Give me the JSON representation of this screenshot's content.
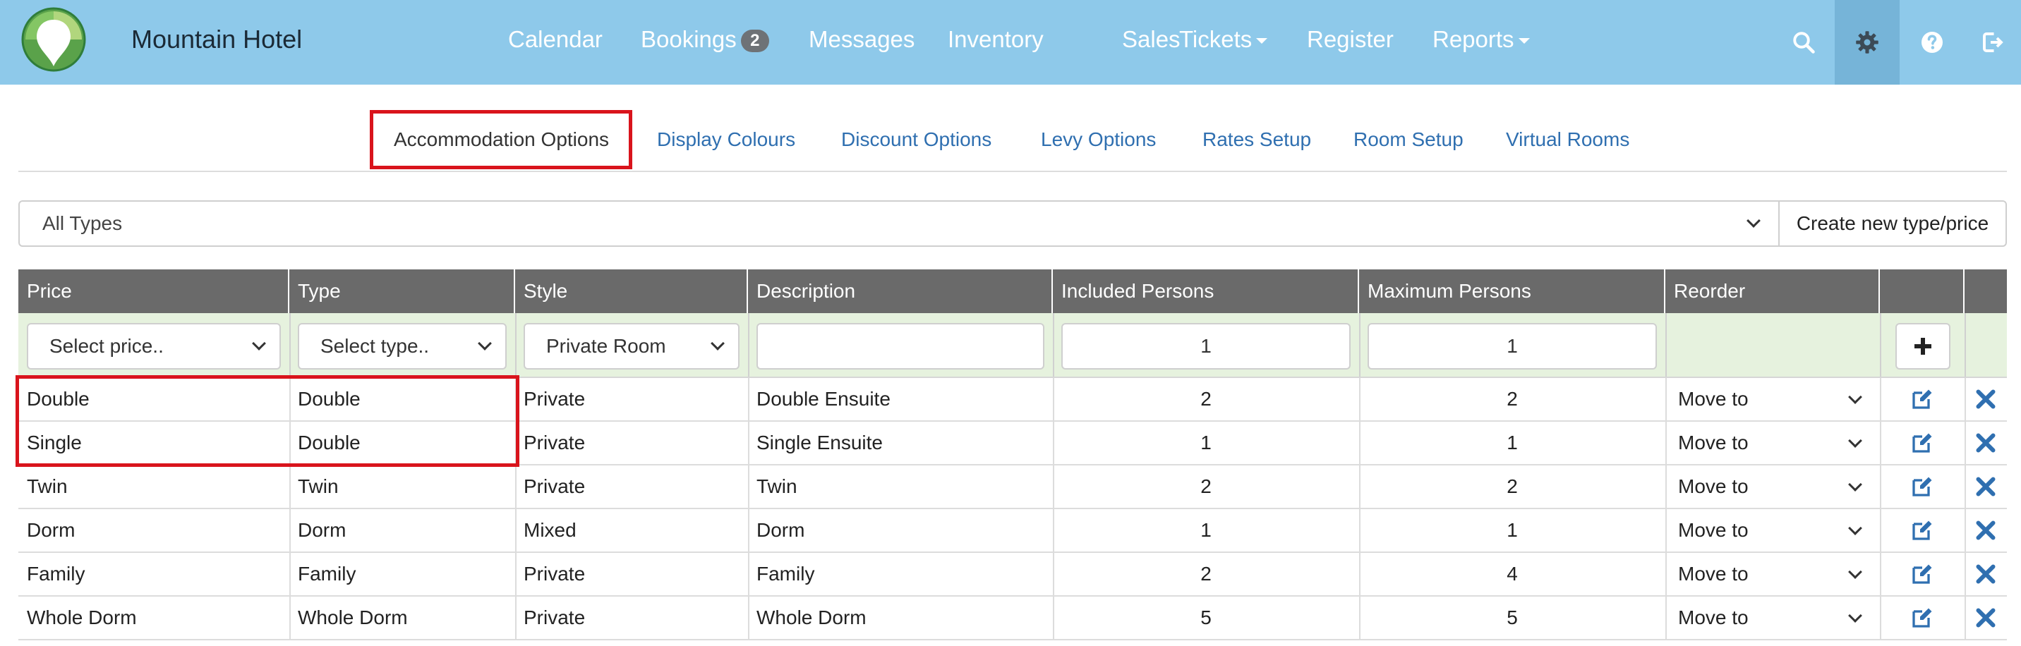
{
  "app": {
    "brand": "Mountain Hotel",
    "colors": {
      "navbar": "#8ec9ea",
      "link": "#2f6fb0",
      "highlight": "#d9141c",
      "header": "#6a6a6a",
      "new_row": "#e6f2de"
    }
  },
  "nav": {
    "calendar": "Calendar",
    "bookings": "Bookings",
    "bookings_badge": "2",
    "messages": "Messages",
    "inventory": "Inventory",
    "sales": "Sales",
    "tickets": "Tickets",
    "register": "Register",
    "reports": "Reports",
    "icons": [
      "search-icon",
      "gear-icon",
      "help-icon",
      "logout-icon"
    ]
  },
  "subtabs": {
    "accommodation": "Accommodation Options",
    "display_colours": "Display Colours",
    "discount": "Discount Options",
    "levy": "Levy Options",
    "rates": "Rates Setup",
    "room": "Room Setup",
    "virtual": "Virtual Rooms",
    "active": "Accommodation Options"
  },
  "filter": {
    "type_select": "All Types",
    "create_button": "Create new type/price"
  },
  "table": {
    "headers": {
      "price": "Price",
      "type": "Type",
      "style": "Style",
      "description": "Description",
      "included": "Included Persons",
      "maximum": "Maximum Persons",
      "reorder": "Reorder"
    },
    "new_row": {
      "price_placeholder": "Select price..",
      "type_placeholder": "Select type..",
      "style_value": "Private Room",
      "description_value": "",
      "included_value": "1",
      "maximum_value": "1"
    },
    "rows": [
      {
        "price": "Double",
        "type": "Double",
        "style": "Private",
        "description": "Double Ensuite",
        "included": "2",
        "maximum": "2",
        "reorder": "Move to"
      },
      {
        "price": "Single",
        "type": "Double",
        "style": "Private",
        "description": "Single Ensuite",
        "included": "1",
        "maximum": "1",
        "reorder": "Move to"
      },
      {
        "price": "Twin",
        "type": "Twin",
        "style": "Private",
        "description": "Twin",
        "included": "2",
        "maximum": "2",
        "reorder": "Move to"
      },
      {
        "price": "Dorm",
        "type": "Dorm",
        "style": "Mixed",
        "description": "Dorm",
        "included": "1",
        "maximum": "1",
        "reorder": "Move to"
      },
      {
        "price": "Family",
        "type": "Family",
        "style": "Private",
        "description": "Family",
        "included": "2",
        "maximum": "4",
        "reorder": "Move to"
      },
      {
        "price": "Whole Dorm",
        "type": "Whole Dorm",
        "style": "Private",
        "description": "Whole Dorm",
        "included": "5",
        "maximum": "5",
        "reorder": "Move to"
      }
    ]
  }
}
